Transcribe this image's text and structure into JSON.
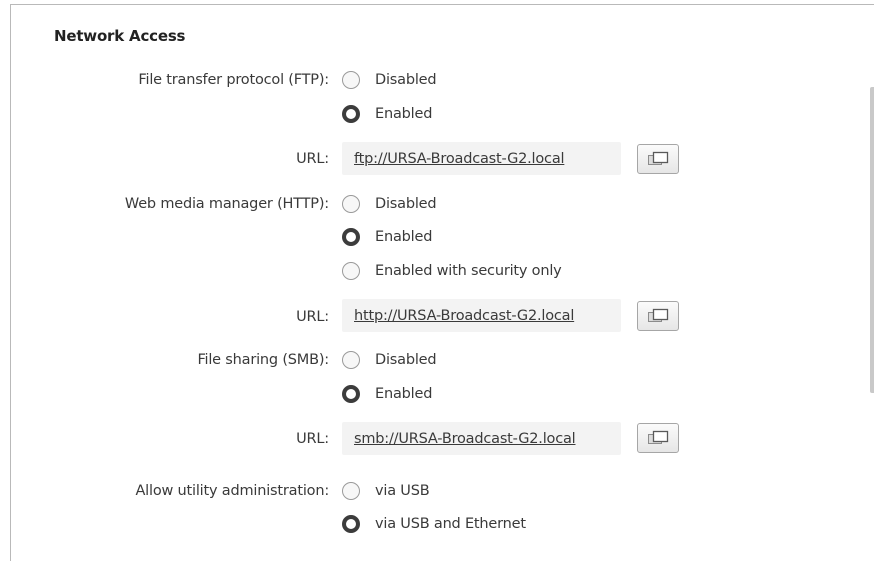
{
  "section": {
    "title": "Network Access"
  },
  "ftp": {
    "label": "File transfer protocol (FTP):",
    "options": [
      {
        "label": "Disabled",
        "selected": false
      },
      {
        "label": "Enabled",
        "selected": true
      }
    ],
    "url_label": "URL:",
    "url": "ftp://URSA-Broadcast-G2.local"
  },
  "http": {
    "label": "Web media manager (HTTP):",
    "options": [
      {
        "label": "Disabled",
        "selected": false
      },
      {
        "label": "Enabled",
        "selected": true
      },
      {
        "label": "Enabled with security only",
        "selected": false
      }
    ],
    "url_label": "URL:",
    "url": "http://URSA-Broadcast-G2.local"
  },
  "smb": {
    "label": "File sharing (SMB):",
    "options": [
      {
        "label": "Disabled",
        "selected": false
      },
      {
        "label": "Enabled",
        "selected": true
      }
    ],
    "url_label": "URL:",
    "url": "smb://URSA-Broadcast-G2.local"
  },
  "admin": {
    "label": "Allow utility administration:",
    "options": [
      {
        "label": "via USB",
        "selected": false
      },
      {
        "label": "via USB and Ethernet",
        "selected": true
      }
    ]
  },
  "icons": {
    "copy": "copy-to-clipboard-icon"
  }
}
